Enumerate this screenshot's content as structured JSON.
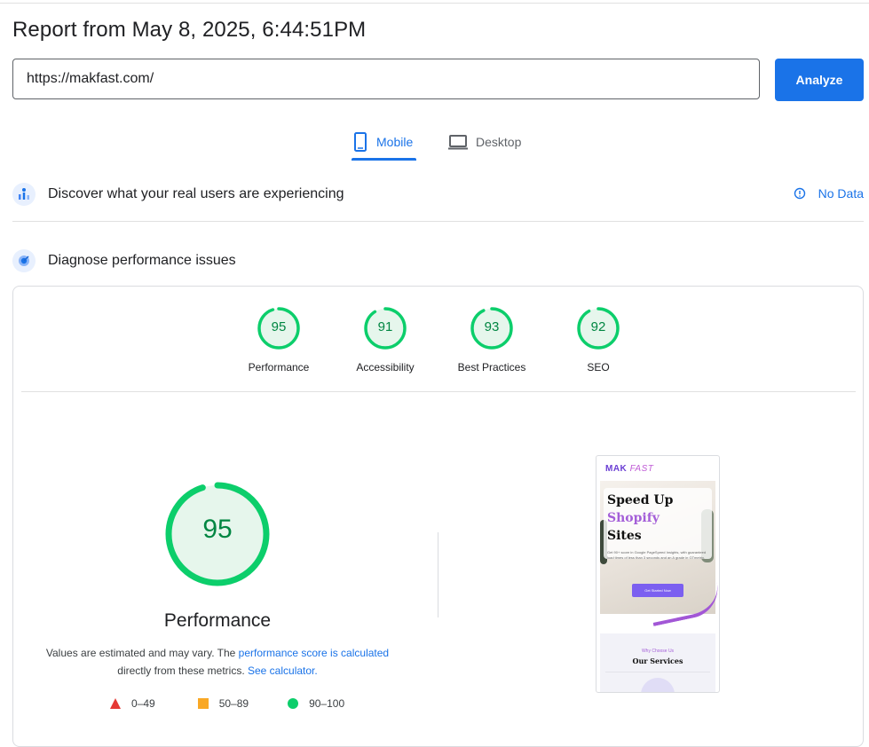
{
  "report": {
    "title": "Report from May 8, 2025, 6:44:51PM"
  },
  "url_input": {
    "value": "https://makfast.com/"
  },
  "analyze_button": {
    "label": "Analyze"
  },
  "tabs": {
    "mobile": "Mobile",
    "desktop": "Desktop",
    "active": "Mobile"
  },
  "field_data": {
    "heading": "Discover what your real users are experiencing",
    "status": "No Data"
  },
  "diagnose": {
    "heading": "Diagnose performance issues"
  },
  "scores": [
    {
      "label": "Performance",
      "value": "95",
      "score": 95
    },
    {
      "label": "Accessibility",
      "value": "91",
      "score": 91
    },
    {
      "label": "Best Practices",
      "value": "93",
      "score": 93
    },
    {
      "label": "SEO",
      "value": "92",
      "score": 92
    }
  ],
  "performance": {
    "value": "95",
    "score": 95,
    "title": "Performance",
    "note_prefix": "Values are estimated and may vary. The ",
    "note_link1": "performance score is calculated",
    "note_middle": "directly from these metrics.",
    "note_link2": "See calculator."
  },
  "legend": [
    {
      "range": "0–49",
      "shape": "triangle",
      "color": "#e53935"
    },
    {
      "range": "50–89",
      "shape": "square",
      "color": "#f9a825"
    },
    {
      "range": "90–100",
      "shape": "circle",
      "color": "#0cce6b"
    }
  ],
  "colors": {
    "accent": "#1a73e8",
    "pass": "#0cce6b",
    "pass_text": "#018642",
    "gauge_fill": "#e6f6ec"
  },
  "screenshot": {
    "logo": "MAK",
    "logo_suffix": "FAST",
    "headline1": "Speed Up",
    "headline2": "Shopify",
    "headline3": "Sites",
    "body": "Get 90+ score in Google PageSpeed Insights, with guaranteed load times of less than 3 seconds and an A grade in GTmetrix.",
    "cta": "Get Started Now",
    "kicker": "Why Choose Us",
    "section_title": "Our Services"
  }
}
